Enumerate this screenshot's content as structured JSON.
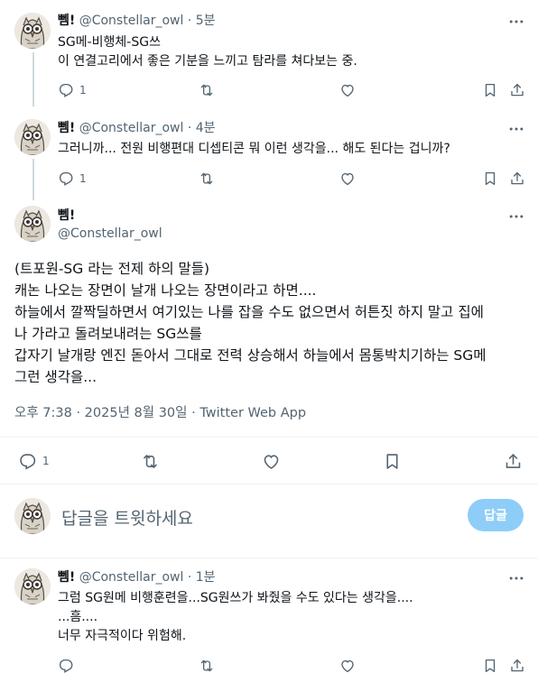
{
  "tweets": [
    {
      "name": "뻼!",
      "handle": "@Constellar_owl",
      "time": "5분",
      "lines": [
        "SG메-비행체-SG쓰",
        "이 연결고리에서 좋은 기분을 느끼고 탐라를 쳐다보는 중."
      ],
      "reply_count": "1"
    },
    {
      "name": "뻼!",
      "handle": "@Constellar_owl",
      "time": "4분",
      "lines": [
        "그러니까... 전원 비행편대 디셉티콘 뭐 이런 생각을... 해도 된다는 겁니까?"
      ],
      "reply_count": "1"
    }
  ],
  "main_tweet": {
    "name": "뻼!",
    "handle": "@Constellar_owl",
    "lines": [
      "(트포원-SG 라는 전제 하의 말들)",
      "캐논 나오는 장면이 날개 나오는 장면이라고 하면....",
      "하늘에서 깔짝딜하면서 여기있는 나를 잡을 수도 없으면서 허튼짓 하지 말고 집에",
      "나 가라고 돌려보내려는 SG쓰를",
      "갑자기 날개랑 엔진 돋아서 그대로 전력 상승해서 하늘에서 몸통박치기하는 SG메",
      "그런 생각을..."
    ],
    "meta": "오후 7:38 · 2025년 8월 30일 · Twitter Web App",
    "reply_count": "1"
  },
  "reply_box": {
    "placeholder": "답글을 트윗하세요",
    "button": "답글"
  },
  "reply_tweet": {
    "name": "뻼!",
    "handle": "@Constellar_owl",
    "time": "1분",
    "lines": [
      "그럼 SG원메 비행훈련을...SG원쓰가 봐줬을 수도 있다는 생각을....",
      "...흠....",
      "너무 자극적이다 위험해."
    ]
  },
  "separator": "·",
  "icons": [
    "reply-icon",
    "retweet-icon",
    "like-icon",
    "bookmark-icon",
    "share-icon",
    "more-icon"
  ],
  "colors": {
    "accent_disabled": "#8ecdf8",
    "muted": "#536471",
    "divider": "#eff3f4",
    "thread": "#cfd9de"
  }
}
